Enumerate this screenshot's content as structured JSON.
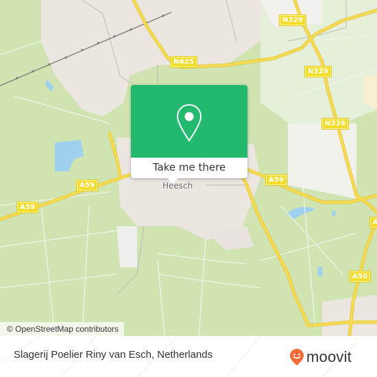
{
  "map": {
    "town_label": "Heesch",
    "road_shields": [
      {
        "id": "n329-top",
        "label": "N329"
      },
      {
        "id": "n625",
        "label": "N625"
      },
      {
        "id": "n329-mid",
        "label": "N329"
      },
      {
        "id": "n329-low",
        "label": "N329"
      },
      {
        "id": "a59-left",
        "label": "A59"
      },
      {
        "id": "a59-center",
        "label": "A59"
      },
      {
        "id": "a59-right",
        "label": "A59"
      },
      {
        "id": "a50-right",
        "label": "A"
      },
      {
        "id": "a50-low",
        "label": "A50"
      }
    ],
    "attribution": "© OpenStreetMap contributors",
    "colors": {
      "land": "#cfe4b0",
      "urban": "#ece6e1",
      "water": "#9fd1ef",
      "road": "#f6dc54",
      "accent": "#22b96f"
    }
  },
  "popup": {
    "icon": "map-pin-icon",
    "cta_label": "Take me there"
  },
  "footer": {
    "place_name": "Slagerij Poelier Riny van Esch, Netherlands",
    "brand": "moovit",
    "brand_icon": "moovit-smiley-pin-icon",
    "brand_color": "#f26b38"
  }
}
